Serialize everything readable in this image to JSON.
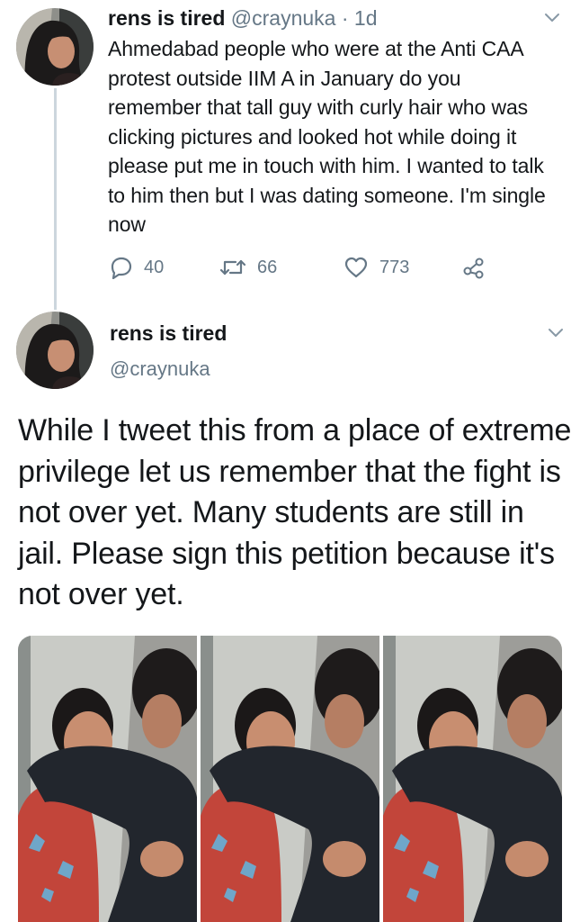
{
  "tweet1": {
    "display_name": "rens is tired",
    "handle": "@craynuka",
    "separator": "·",
    "time": "1d",
    "text": "Ahmedabad people who were at the Anti CAA protest outside IIM A in January do you remember that tall guy with curly hair who was clicking pictures and looked hot while doing it please put me in touch with him. I wanted to talk to him then but I was dating someone. I'm single now",
    "replies": "40",
    "retweets": "66",
    "likes": "773"
  },
  "tweet2": {
    "display_name": "rens is tired",
    "handle": "@craynuka",
    "text": "While I tweet this from a place of extreme privilege let us remember that the fight is not over yet. Many students are still in jail. Please sign this petition because it's not over yet."
  },
  "icons": {
    "reply": "reply-icon",
    "retweet": "retweet-icon",
    "like": "heart-icon",
    "share": "share-icon",
    "more": "chevron-down-icon"
  },
  "colors": {
    "text": "#14171a",
    "secondary": "#657786",
    "thread_line": "#ccd6dd"
  }
}
